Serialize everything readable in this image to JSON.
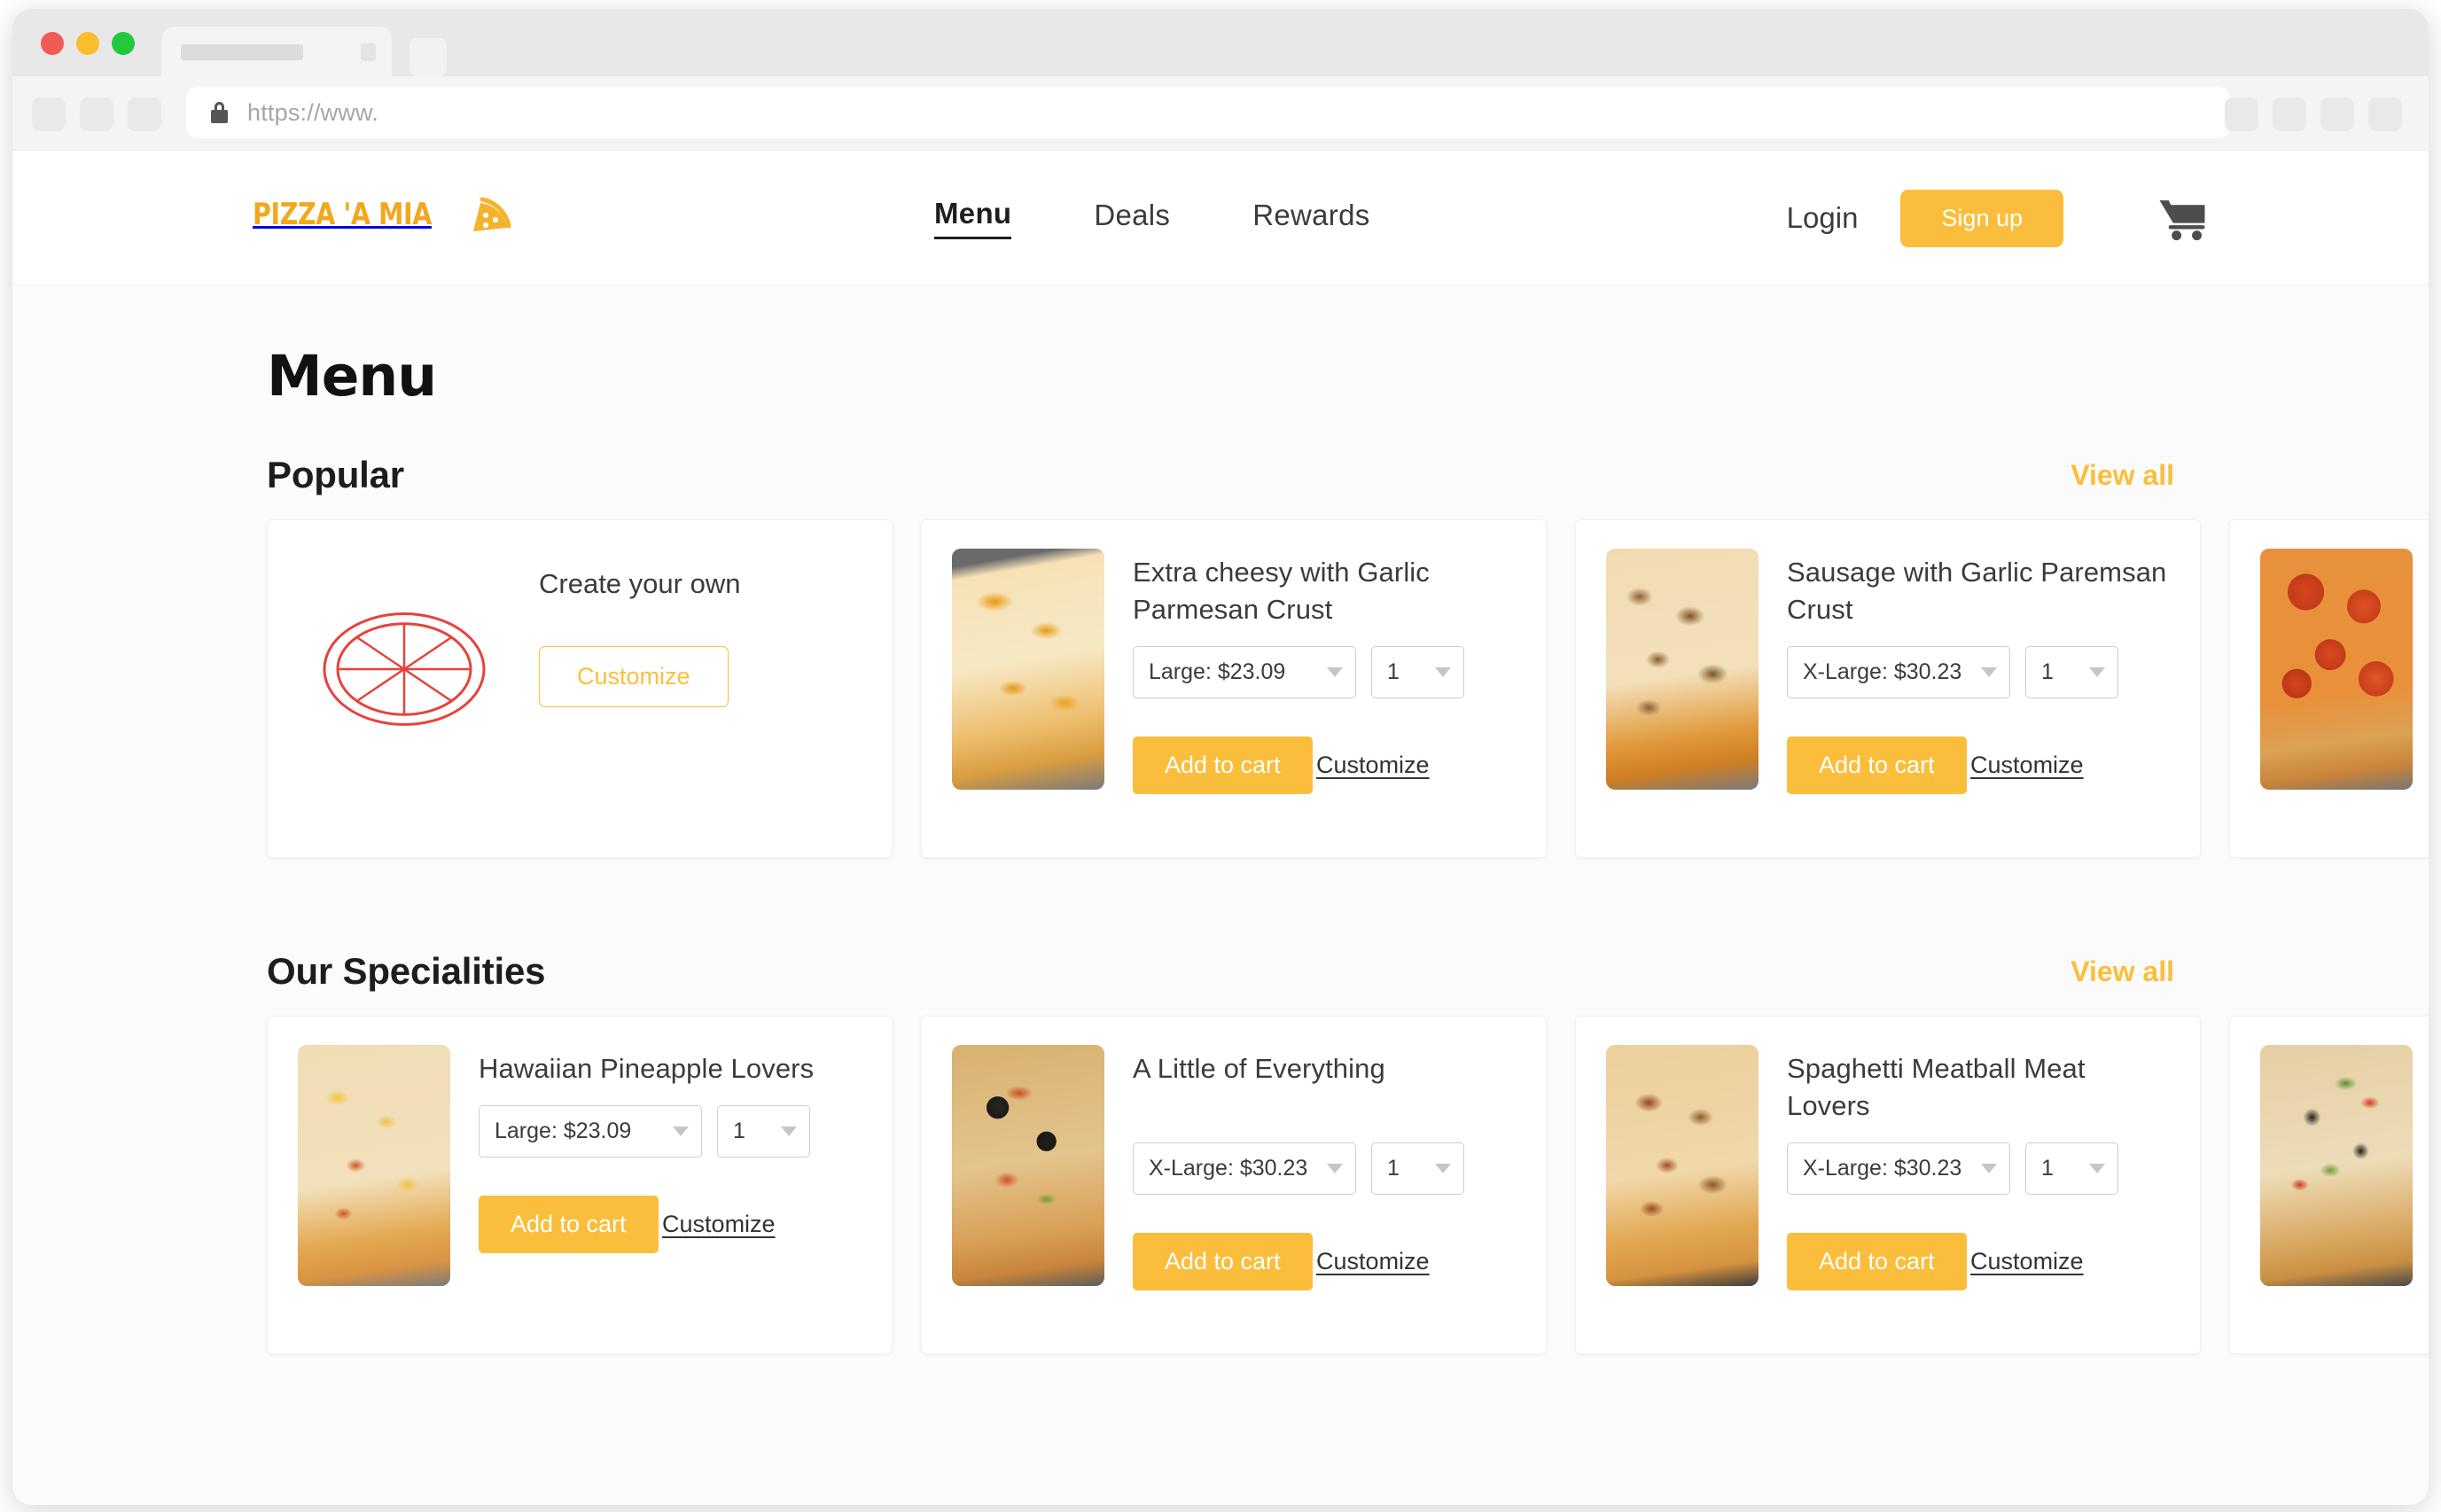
{
  "browser": {
    "url_text": "https://www.",
    "lock_icon": "lock-icon",
    "traffic_lights": [
      "close",
      "minimize",
      "maximize"
    ]
  },
  "header": {
    "brand_name": "PIZZA 'A MIA",
    "brand_mark_icon": "pizza-slice-icon",
    "nav": [
      {
        "label": "Menu",
        "active": true
      },
      {
        "label": "Deals",
        "active": false
      },
      {
        "label": "Rewards",
        "active": false
      }
    ],
    "login_label": "Login",
    "signup_label": "Sign up",
    "cart_icon": "shopping-cart-icon"
  },
  "page": {
    "title": "Menu"
  },
  "sections": [
    {
      "title": "Popular",
      "view_all_label": "View all",
      "create_card": {
        "title": "Create your own",
        "button_label": "Customize",
        "art_icon": "pizza-outline-icon"
      },
      "cards": [
        {
          "title": "Extra cheesy with Garlic Parmesan Crust",
          "size_value": "Large: $23.09",
          "qty_value": "1",
          "add_label": "Add to cart",
          "customize_label": "Customize",
          "thumb": "ph-cheese"
        },
        {
          "title": "Sausage with Garlic Paremsan Crust",
          "size_value": "X-Large: $30.23",
          "qty_value": "1",
          "add_label": "Add to cart",
          "customize_label": "Customize",
          "thumb": "ph-sausage"
        },
        {
          "title": "",
          "size_value": "",
          "qty_value": "",
          "add_label": "",
          "customize_label": "",
          "thumb": "ph-pepperoni"
        }
      ]
    },
    {
      "title": "Our Specialities",
      "view_all_label": "View all",
      "cards": [
        {
          "title": "Hawaiian Pineapple Lovers",
          "size_value": "Large: $23.09",
          "qty_value": "1",
          "add_label": "Add to cart",
          "customize_label": "Customize",
          "thumb": "ph-hawaiian"
        },
        {
          "title": "A Little of Everything",
          "size_value": "X-Large: $30.23",
          "qty_value": "1",
          "add_label": "Add to cart",
          "customize_label": "Customize",
          "thumb": "ph-everything"
        },
        {
          "title": "Spaghetti Meatball Meat Lovers",
          "size_value": "X-Large: $30.23",
          "qty_value": "1",
          "add_label": "Add to cart",
          "customize_label": "Customize",
          "thumb": "ph-meatball"
        },
        {
          "title": "",
          "size_value": "",
          "qty_value": "",
          "add_label": "",
          "customize_label": "",
          "thumb": "ph-veggie"
        }
      ]
    }
  ],
  "colors": {
    "accent": "#FBBE3C",
    "brand": "#F2A81D",
    "create_outline": "#E5433B",
    "page_background": "#FBFBFB",
    "card_background": "#FFFFFF",
    "text": "#3B3B3B"
  }
}
